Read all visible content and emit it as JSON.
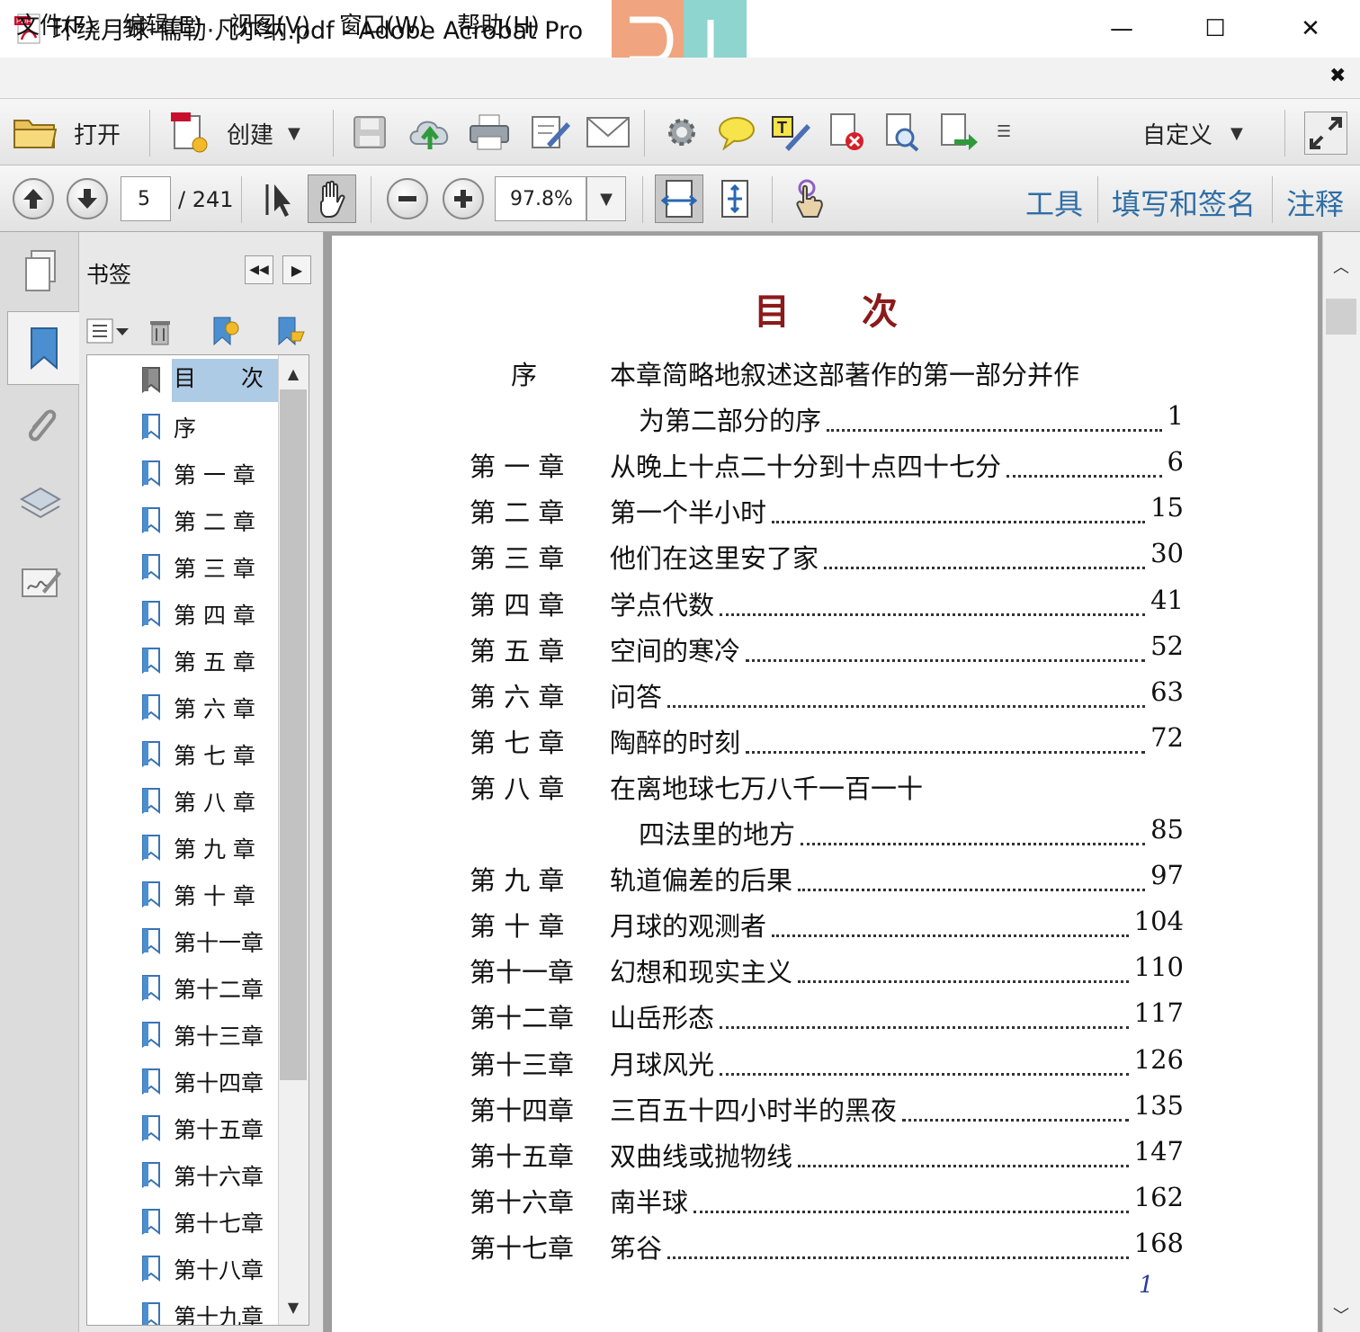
{
  "window": {
    "title": "环绕月球-儒勒·凡尔纳.pdf - Adobe Acrobat Pro",
    "icon": "pdf-file-icon",
    "controls": {
      "minimize": "—",
      "maximize": "☐",
      "close": "✕"
    }
  },
  "menu": {
    "items": [
      "文件(F)",
      "编辑(E)",
      "视图(V)",
      "窗口(W)",
      "帮助(H)"
    ],
    "close_glyph": "✖"
  },
  "toolbar": {
    "open_label": "打开",
    "create_label": "创建",
    "customize_label": "自定义",
    "icons": [
      "folder-open-icon",
      "create-pdf-icon",
      "save-icon",
      "cloud-upload-icon",
      "print-icon",
      "edit-icon",
      "email-icon",
      "gear-icon",
      "comment-icon",
      "typewriter-icon",
      "delete-page-icon",
      "search-page-icon",
      "export-icon",
      "more-icon",
      "expand-icon"
    ]
  },
  "nav": {
    "page_current": "5",
    "page_total": "/ 241",
    "zoom": "97.8%",
    "panel_links": [
      "工具",
      "填写和签名",
      "注释"
    ]
  },
  "bookmarks": {
    "title": "书签",
    "items": [
      "目　　次",
      "序",
      "第 一 章",
      "第 二 章",
      "第 三 章",
      "第 四 章",
      "第 五 章",
      "第 六 章",
      "第 七 章",
      "第 八 章",
      "第 九 章",
      "第 十 章",
      "第十一章",
      "第十二章",
      "第十三章",
      "第十四章",
      "第十五章",
      "第十六章",
      "第十七章",
      "第十八章",
      "第十九章"
    ],
    "selected_index": 0
  },
  "document": {
    "heading": "目　　次",
    "entries": [
      {
        "label": "序",
        "title": "本章简略地叙述这部著作的第一部分并作",
        "cont": "为第二部分的序",
        "page": "1"
      },
      {
        "label": "第 一 章",
        "title": "从晚上十点二十分到十点四十七分",
        "page": "6"
      },
      {
        "label": "第 二 章",
        "title": "第一个半小时",
        "page": "15"
      },
      {
        "label": "第 三 章",
        "title": "他们在这里安了家",
        "page": "30"
      },
      {
        "label": "第 四 章",
        "title": "学点代数",
        "page": "41"
      },
      {
        "label": "第 五 章",
        "title": "空间的寒冷",
        "page": "52"
      },
      {
        "label": "第 六 章",
        "title": "问答",
        "page": "63"
      },
      {
        "label": "第 七 章",
        "title": "陶醉的时刻",
        "page": "72"
      },
      {
        "label": "第 八 章",
        "title": "在离地球七万八千一百一十",
        "cont": "四法里的地方",
        "page": "85"
      },
      {
        "label": "第 九 章",
        "title": "轨道偏差的后果",
        "page": "97"
      },
      {
        "label": "第 十 章",
        "title": "月球的观测者",
        "page": "104"
      },
      {
        "label": "第十一章",
        "title": "幻想和现实主义",
        "page": "110"
      },
      {
        "label": "第十二章",
        "title": "山岳形态",
        "page": "117"
      },
      {
        "label": "第十三章",
        "title": "月球风光",
        "page": "126"
      },
      {
        "label": "第十四章",
        "title": "三百五十四小时半的黑夜",
        "page": "135"
      },
      {
        "label": "第十五章",
        "title": "双曲线或抛物线",
        "page": "147"
      },
      {
        "label": "第十六章",
        "title": "南半球",
        "page": "162"
      },
      {
        "label": "第十七章",
        "title": "笫谷",
        "page": "168"
      }
    ],
    "page_number": "1"
  },
  "colors": {
    "heading": "#8b1a1a",
    "link": "#2f6ea5",
    "page_number": "#2a3aa0",
    "selection": "#aecbe6"
  }
}
